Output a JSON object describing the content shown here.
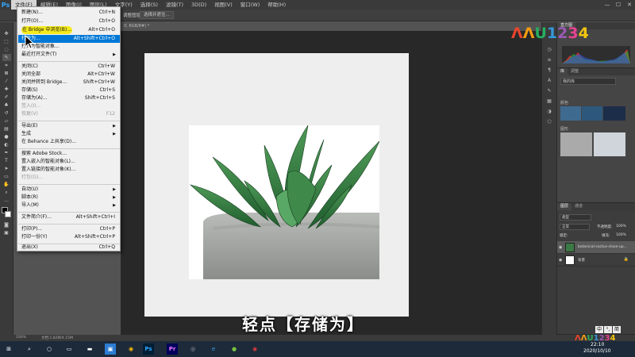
{
  "app": {
    "logo": "Ps"
  },
  "menubar": {
    "items": [
      "文件(F)",
      "编辑(E)",
      "图像(I)",
      "图层(L)",
      "文字(Y)",
      "选择(S)",
      "滤镜(T)",
      "3D(D)",
      "视图(V)",
      "窗口(W)",
      "帮助(H)"
    ],
    "win_min": "—",
    "win_max": "☐",
    "win_close": "✕"
  },
  "options": {
    "btn1": "选择并遮住...",
    "partial_label": "调整图层",
    "partial_field": "宽:"
  },
  "document": {
    "tab": "lf, RGB/8#) *"
  },
  "file_menu": {
    "items": [
      {
        "label": "新建(N)...",
        "shortcut": "Ctrl+N"
      },
      {
        "label": "打开(O)...",
        "shortcut": "Ctrl+O"
      },
      {
        "label": "在 Bridge 中浏览(B)...",
        "shortcut": "Alt+Ctrl+O"
      },
      {
        "label": "打开为...",
        "shortcut": "Alt+Shift+Ctrl+O"
      },
      {
        "label": "打开为智能对象...",
        "shortcut": ""
      },
      {
        "label": "最近打开文件(T)",
        "shortcut": ""
      },
      {
        "label": "关闭(C)",
        "shortcut": "Ctrl+W"
      },
      {
        "label": "关闭全部",
        "shortcut": "Alt+Ctrl+W"
      },
      {
        "label": "关闭并转到 Bridge...",
        "shortcut": "Shift+Ctrl+W"
      },
      {
        "label": "存储(S)",
        "shortcut": "Ctrl+S"
      },
      {
        "label": "存储为(A)...",
        "shortcut": "Shift+Ctrl+S"
      },
      {
        "label": "签入(I)...",
        "shortcut": ""
      },
      {
        "label": "恢复(V)",
        "shortcut": "F12"
      },
      {
        "label": "导出(E)",
        "shortcut": ""
      },
      {
        "label": "生成",
        "shortcut": ""
      },
      {
        "label": "在 Behance 上共享(D)...",
        "shortcut": ""
      },
      {
        "label": "搜索 Adobe Stock...",
        "shortcut": ""
      },
      {
        "label": "置入嵌入的智能对象(L)...",
        "shortcut": ""
      },
      {
        "label": "置入链接的智能对象(K)...",
        "shortcut": ""
      },
      {
        "label": "打包(G)...",
        "shortcut": ""
      },
      {
        "label": "自动(U)",
        "shortcut": ""
      },
      {
        "label": "脚本(R)",
        "shortcut": ""
      },
      {
        "label": "导入(M)",
        "shortcut": ""
      },
      {
        "label": "文件简介(F)...",
        "shortcut": "Alt+Shift+Ctrl+I"
      },
      {
        "label": "打印(P)...",
        "shortcut": "Ctrl+P"
      },
      {
        "label": "打印一份(Y)",
        "shortcut": "Alt+Shift+Ctrl+P"
      },
      {
        "label": "退出(X)",
        "shortcut": "Ctrl+Q"
      }
    ]
  },
  "subtitle": "轻点【存储为】",
  "status": {
    "zoom": "100%",
    "doc": "文档:1.82M/4.15M"
  },
  "panels": {
    "tab_histogram": "直方图",
    "tab_library": "库",
    "tab_adjust": "调整",
    "lib_select": "我的库",
    "colors_label": "颜色",
    "graphics_label": "图形",
    "layers_tab": "图层",
    "channels_tab": "通道",
    "kind": "类型",
    "blend": "正常",
    "opacity_label": "不透明度:",
    "opacity": "100%",
    "lock_label": "锁定:",
    "fill_label": "填充:",
    "fill": "100%",
    "layer1": "botanical-cactus-close-up...",
    "layer2": "背景"
  },
  "ime": {
    "c1": "中",
    "c2": "°,",
    "c3": "简"
  },
  "taskbar": {
    "time": "22:10",
    "date": "2020/10/10"
  },
  "watermark": {
    "text": "ɅɅU1234",
    "small": "ɅɅU1234"
  }
}
